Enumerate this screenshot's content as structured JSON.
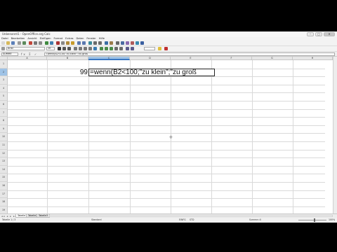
{
  "window": {
    "title": "Unbenannt1 - OpenOffice.org Calc",
    "minimize": "–",
    "maximize": "□",
    "close": "✕"
  },
  "menubar": [
    "Datei",
    "Bearbeiten",
    "Ansicht",
    "Einfügen",
    "Format",
    "Extras",
    "Daten",
    "Fenster",
    "Hilfe"
  ],
  "toolbar": {
    "font_name": "Arial",
    "font_size": "10"
  },
  "formula_bar": {
    "cell_ref": "SUMME",
    "icons": "fx Σ ✓",
    "formula": "=wenn(B2<100;\"zu klein\";\"zu groß"
  },
  "grid": {
    "columns": [
      "A",
      "B",
      "C",
      "D",
      "E",
      "F",
      "G",
      "H"
    ],
    "active_column": "C",
    "rows": [
      "1",
      "2",
      "3",
      "4",
      "5",
      "6",
      "7",
      "8",
      "9",
      "10",
      "11",
      "12",
      "13",
      "14",
      "15",
      "16",
      "17",
      "18",
      "19"
    ],
    "active_row": "2",
    "cells": {
      "B2": "99",
      "C2": "=wenn(B2<100;\"zu klein\";\"zu groß"
    }
  },
  "sheet_tabs": {
    "nav": "◂◂ ◂ ▸ ▸▸",
    "tabs": [
      "Tabelle1",
      "Tabelle2",
      "Tabelle3"
    ],
    "active": "Tabelle1"
  },
  "statusbar": {
    "sheet": "Tabelle 1 / 3",
    "style": "Standard",
    "mode": "EINFG",
    "std": "STD",
    "sum": "Summe=0",
    "zoom": "100%"
  }
}
